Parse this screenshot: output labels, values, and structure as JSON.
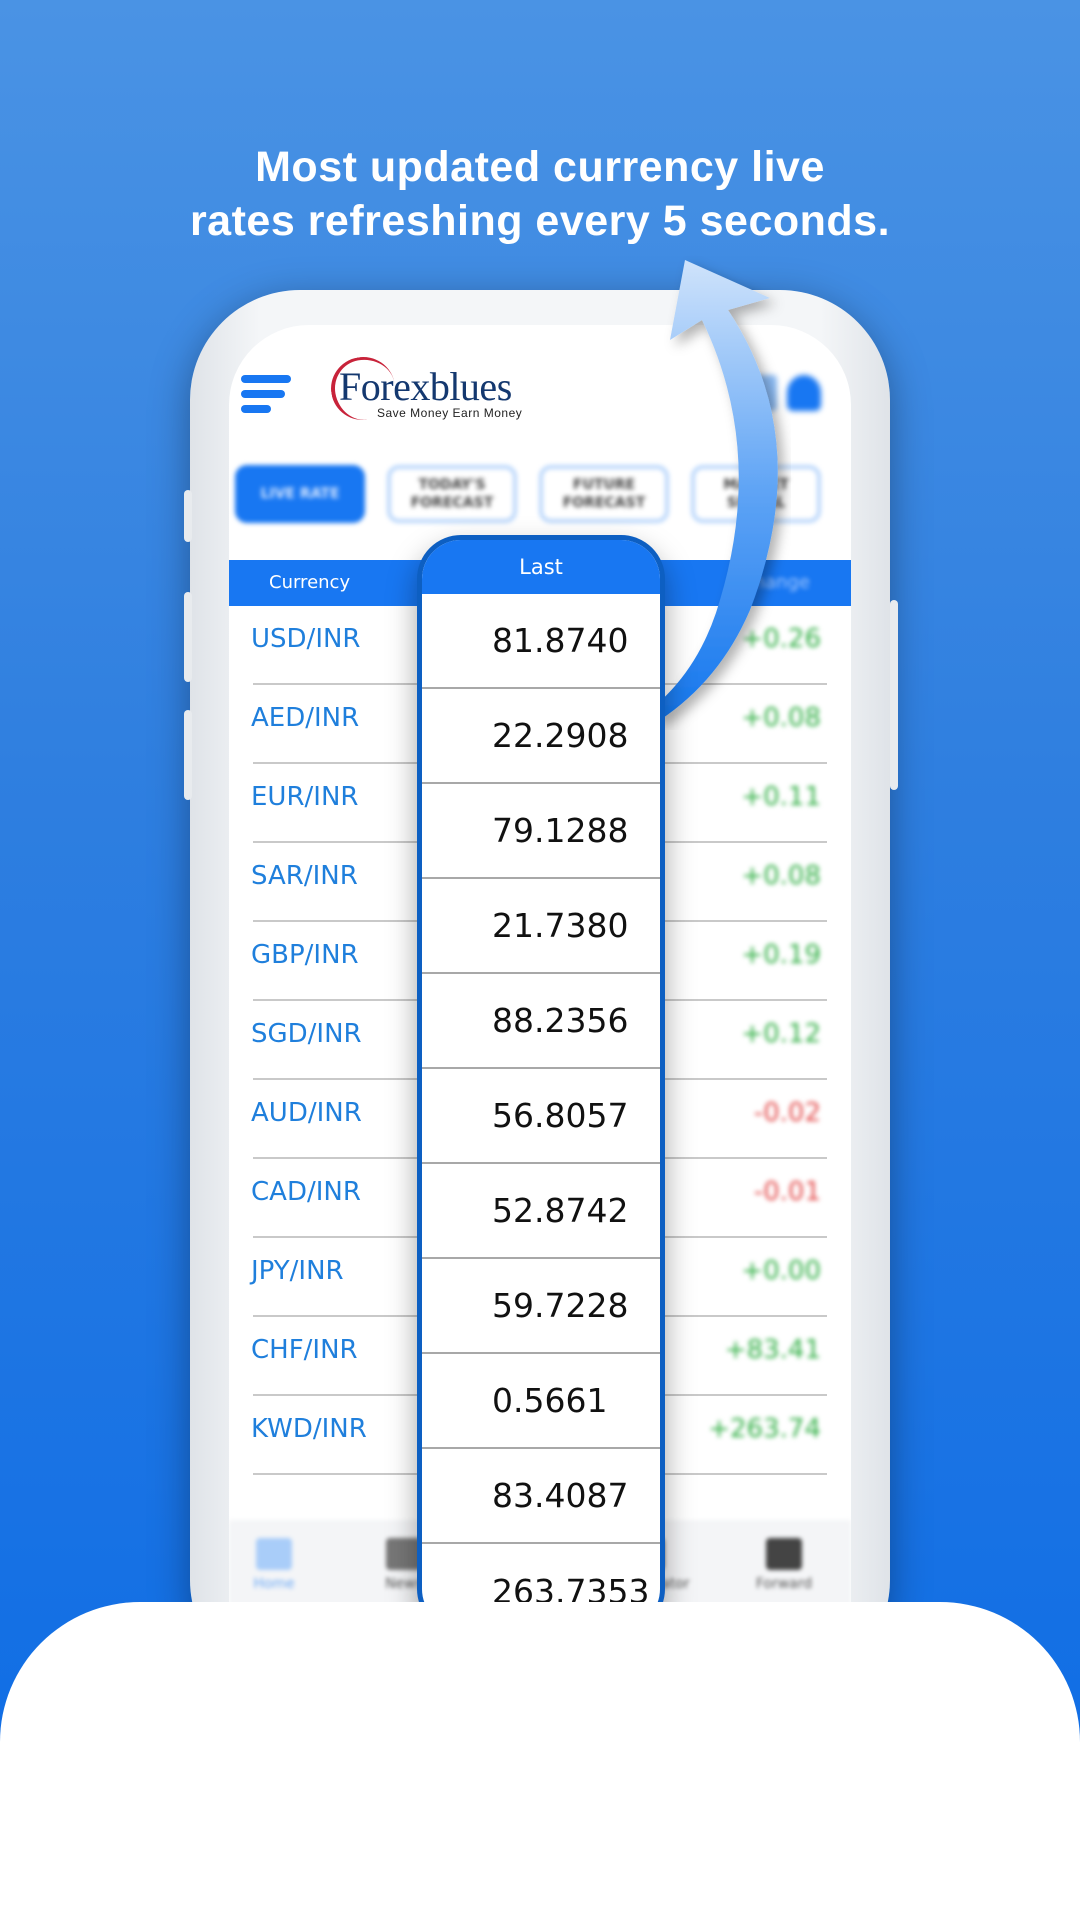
{
  "headline": {
    "line1": "Most updated currency live",
    "line2": "rates refreshing every 5 seconds."
  },
  "app": {
    "logo_text": "Forexblues",
    "logo_tagline": "Save Money Earn Money",
    "icons": [
      "menu-icon",
      "calendar-icon",
      "bell-icon"
    ]
  },
  "tabs": [
    {
      "label": "LIVE RATE",
      "active": true
    },
    {
      "label": "TODAY'S FORECAST",
      "active": false
    },
    {
      "label": "FUTURE FORECAST",
      "active": false
    },
    {
      "label": "MARKET SIGNAL",
      "active": false
    }
  ],
  "table": {
    "headers": {
      "currency": "Currency",
      "last": "Last",
      "change": "Change"
    },
    "rows": [
      {
        "pair": "USD/INR",
        "last": "81.8740",
        "change": "+0.26"
      },
      {
        "pair": "AED/INR",
        "last": "22.2908",
        "change": "+0.08"
      },
      {
        "pair": "EUR/INR",
        "last": "79.1288",
        "change": "+0.11"
      },
      {
        "pair": "SAR/INR",
        "last": "21.7380",
        "change": "+0.08"
      },
      {
        "pair": "GBP/INR",
        "last": "88.2356",
        "change": "+0.19"
      },
      {
        "pair": "SGD/INR",
        "last": "56.8057",
        "change": "+0.12"
      },
      {
        "pair": "AUD/INR",
        "last": "52.8742",
        "change": "-0.02"
      },
      {
        "pair": "CAD/INR",
        "last": "59.7228",
        "change": "-0.01"
      },
      {
        "pair": "JPY/INR",
        "last": "0.5661",
        "change": "+0.00"
      },
      {
        "pair": "CHF/INR",
        "last": "83.4087",
        "change": "+83.41"
      },
      {
        "pair": "KWD/INR",
        "last": "263.7353",
        "change": "+263.74"
      }
    ]
  },
  "bottom_nav": [
    {
      "label": "Home",
      "icon": "home-icon",
      "active": true
    },
    {
      "label": "News",
      "icon": "news-icon",
      "active": false
    },
    {
      "label": "Calculator",
      "icon": "calculator-icon",
      "active": false
    },
    {
      "label": "Forward",
      "icon": "chart-icon",
      "active": false
    }
  ],
  "colors": {
    "brand_blue": "#1877f2",
    "positive": "#2fae43",
    "negative": "#e24747",
    "pair_text": "#1f7fdc"
  }
}
